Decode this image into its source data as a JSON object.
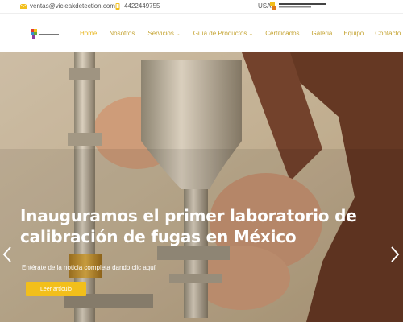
{
  "topbar": {
    "email": "ventas@vicleakdetection.com",
    "phone": "4422449755",
    "country": "USA",
    "email_icon": "envelope-icon",
    "phone_icon": "phone-icon"
  },
  "nav": {
    "items": [
      {
        "label": "Home",
        "dropdown": false,
        "active": true
      },
      {
        "label": "Nosotros",
        "dropdown": false
      },
      {
        "label": "Servicios",
        "dropdown": true
      },
      {
        "label": "Guía de Productos",
        "dropdown": true
      },
      {
        "label": "Certificados",
        "dropdown": false
      },
      {
        "label": "Galeria",
        "dropdown": false
      },
      {
        "label": "Equipo",
        "dropdown": false
      },
      {
        "label": "Contacto",
        "dropdown": false
      }
    ],
    "chevron": "⌄"
  },
  "hero": {
    "title_line1": "Inauguramos el primer laboratorio de",
    "title_line2": "calibración de fugas en México",
    "subtitle": "Entérate de la noticia completa dando clic aquí",
    "button_label": "Leer artículo",
    "prev_icon": "chevron-left-icon",
    "next_icon": "chevron-right-icon"
  },
  "colors": {
    "accent": "#e8b51b",
    "button": "#f2bf1b",
    "nav_text": "#c5a433"
  }
}
